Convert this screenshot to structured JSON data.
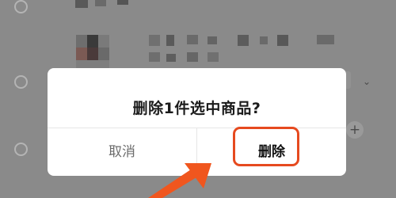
{
  "dialog": {
    "title": "删除1件选中商品?",
    "cancel_label": "取消",
    "confirm_label": "删除"
  },
  "background": {
    "plus_glyph": "+",
    "chevron_glyph": "⌄"
  },
  "colors": {
    "overlay": "#8a8a8a",
    "dialog_bg": "#ffffff",
    "highlight": "#e64a1f",
    "arrow": "#f0561e"
  }
}
